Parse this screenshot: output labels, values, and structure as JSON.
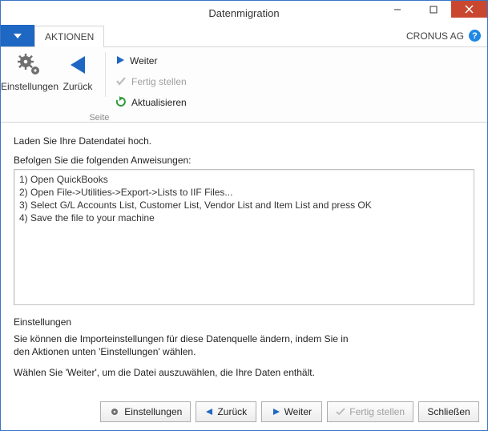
{
  "window": {
    "title": "Datenmigration"
  },
  "ribbon": {
    "tabs": {
      "actions": "AKTIONEN"
    },
    "company": "CRONUS AG",
    "settings": "Einstellungen",
    "back": "Zurück",
    "next": "Weiter",
    "finish": "Fertig stellen",
    "refresh": "Aktualisieren",
    "group_caption": "Seite"
  },
  "content": {
    "lead1": "Laden Sie Ihre Datendatei hoch.",
    "lead2": "Befolgen Sie die folgenden Anweisungen:",
    "instructions": "1) Open QuickBooks\n2) Open File->Utilities->Export->Lists to IIF Files...\n3) Select G/L Accounts List, Customer List, Vendor List and Item List and press OK\n4) Save the file to your machine",
    "settings_header": "Einstellungen",
    "settings_para": "Sie können die Importeinstellungen für diese Datenquelle ändern, indem Sie in den Aktionen unten 'Einstellungen' wählen.",
    "next_para": "Wählen Sie 'Weiter', um die Datei auszuwählen, die Ihre Daten enthält."
  },
  "footer": {
    "settings": "Einstellungen",
    "back": "Zurück",
    "next": "Weiter",
    "finish": "Fertig stellen",
    "close": "Schließen"
  }
}
